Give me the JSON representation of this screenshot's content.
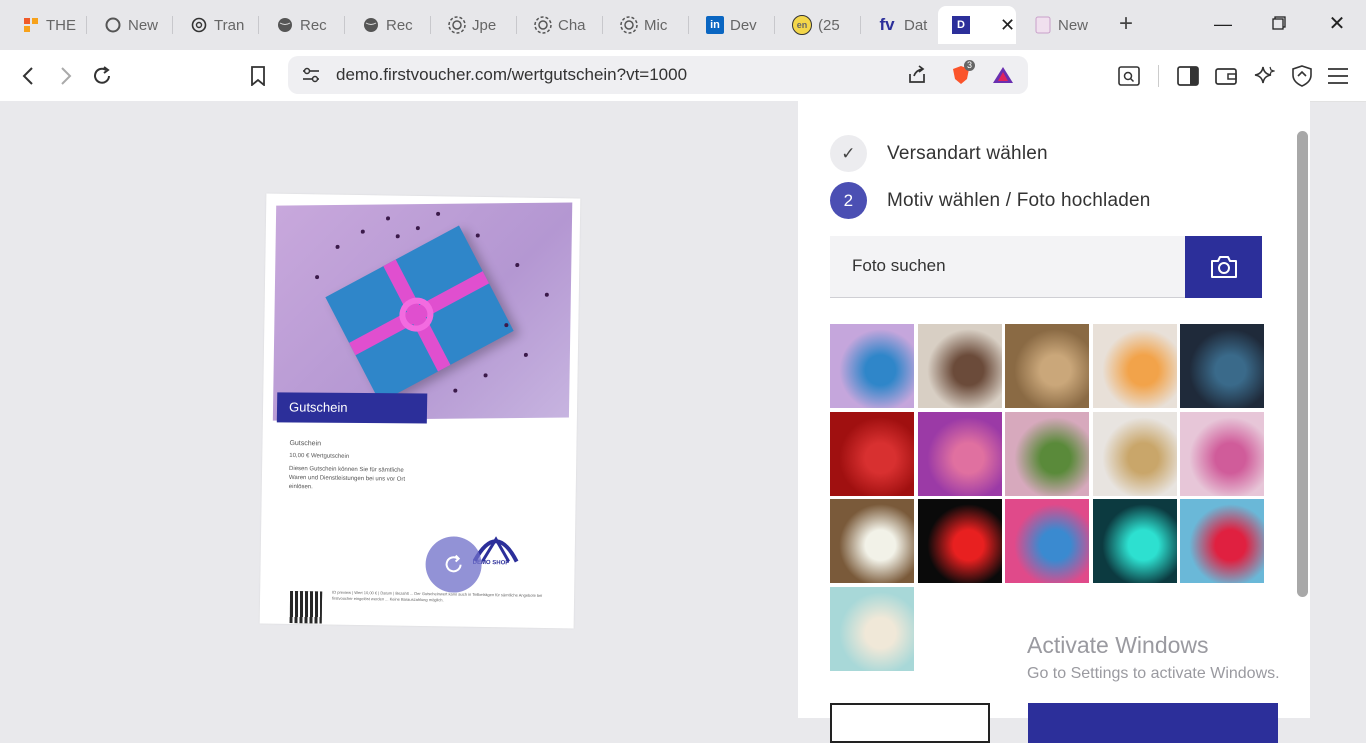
{
  "tabs": [
    {
      "label": "THE",
      "icon": "orange-grid-icon"
    },
    {
      "label": "New",
      "icon": "c-logo-icon"
    },
    {
      "label": "Tran",
      "icon": "openai-icon"
    },
    {
      "label": "Rec",
      "icon": "globe-icon"
    },
    {
      "label": "Rec",
      "icon": "globe-icon"
    },
    {
      "label": "Jpe",
      "icon": "spiral-icon"
    },
    {
      "label": "Cha",
      "icon": "spiral-icon"
    },
    {
      "label": "Mic",
      "icon": "spiral-icon"
    },
    {
      "label": "Dev",
      "icon": "linkedin-icon"
    },
    {
      "label": "(25",
      "icon": "en-icon"
    },
    {
      "label": "Dat",
      "icon": "fv-icon"
    },
    {
      "label": "",
      "icon": "d-icon",
      "active": true
    },
    {
      "label": "New",
      "icon": "newtab-icon"
    }
  ],
  "toolbar": {
    "url": "demo.firstvoucher.com/wertgutschein?vt=1000",
    "brave_badge": "3"
  },
  "voucher": {
    "label": "Gutschein",
    "title": "Gutschein",
    "value_line": "10,00 € Wertgutschein",
    "desc": "Diesen Gutschein können Sie für sämtliche Waren und Dienstleistungen bei uns vor Ort einlösen.",
    "logo_text": "DEMO SHOP",
    "footer": "ID preview | Wert 10,00 € | Datum | Bezahlt ... Der Gutscheinwert kann auch in Teilbeträgen für sämtliche Angebote bei firstvoucher eingelöst werden ... Keine Barauszahlung möglich."
  },
  "panel": {
    "step1": {
      "badge": "✓",
      "label": "Versandart wählen"
    },
    "step2": {
      "badge": "2",
      "label": "Motiv wählen / Foto hochladen"
    },
    "search_label": "Foto suchen"
  },
  "photos": [
    {
      "name": "gift-box",
      "colors": [
        "#c5a6dc",
        "#2f86c9"
      ]
    },
    {
      "name": "woman-kitchen",
      "colors": [
        "#d8cfc4",
        "#6b4b3a"
      ]
    },
    {
      "name": "gift-wrapping",
      "colors": [
        "#8a6a44",
        "#caa77a"
      ]
    },
    {
      "name": "sushi",
      "colors": [
        "#e8e0d8",
        "#f2a34a"
      ]
    },
    {
      "name": "birthday-cake",
      "colors": [
        "#1f2a3a",
        "#3a6a8a"
      ]
    },
    {
      "name": "red-hearts",
      "colors": [
        "#a01010",
        "#d83030"
      ]
    },
    {
      "name": "flowers",
      "colors": [
        "#9b3aa6",
        "#e070a0"
      ]
    },
    {
      "name": "gifts-pink",
      "colors": [
        "#d7a9bd",
        "#5a8a3a"
      ]
    },
    {
      "name": "love-balloon",
      "colors": [
        "#e8e4e0",
        "#c9a66a"
      ]
    },
    {
      "name": "pink-cupcake",
      "colors": [
        "#e7c6d8",
        "#d05c9a"
      ]
    },
    {
      "name": "daisies",
      "colors": [
        "#7a5a3a",
        "#f2f2e8"
      ]
    },
    {
      "name": "neon-i-love-u",
      "colors": [
        "#0a0a0a",
        "#e82020"
      ]
    },
    {
      "name": "candies",
      "colors": [
        "#e04a8a",
        "#3a8ad0"
      ]
    },
    {
      "name": "happy-birthday-neon",
      "colors": [
        "#0c3a40",
        "#2de0d0"
      ]
    },
    {
      "name": "heart-balloons",
      "colors": [
        "#6ab8d8",
        "#e02040"
      ]
    },
    {
      "name": "cake-candles",
      "colors": [
        "#a8d8d8",
        "#f0e8d8"
      ]
    }
  ],
  "activate": {
    "line1": "Activate Windows",
    "line2": "Go to Settings to activate Windows."
  }
}
